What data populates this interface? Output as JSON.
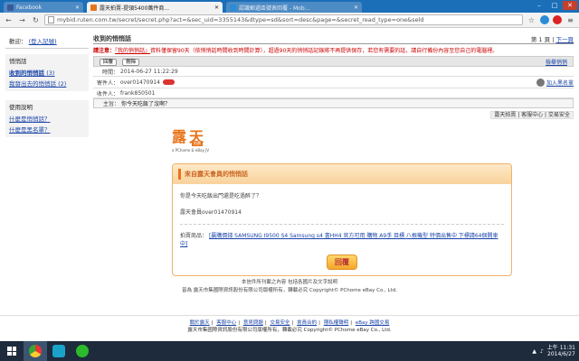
{
  "browser": {
    "tabs": [
      {
        "label": "Facebook",
        "active": false,
        "color": "#3b5998"
      },
      {
        "label": "露天拍賣-提領5400萬件商...",
        "active": true,
        "color": "#e8741a"
      },
      {
        "label": "認識郵遞區號表回覆 - Mob...",
        "active": false,
        "color": "#2a8bd6"
      }
    ],
    "address": "mybid.ruten.com.tw/secret/secret.php?act=&sec_uid=3355143&dtype=sd&sort=desc&page=&secret_read_type=one&seld",
    "controls": [
      "–",
      "□",
      "✕"
    ]
  },
  "sidebar": {
    "account_prefix": "歡迎：",
    "account_link": "(登入記號)",
    "msg_title": "悄悄話",
    "received_link": "收到的悄悄話",
    "received_count": "(3)",
    "sent_link": "我發出去的悄悄話",
    "sent_count": "(2)",
    "help_title": "使用說明",
    "help1": "什麼是悄悄話？",
    "help2": "什麼是黑名單？"
  },
  "main": {
    "title": "收到的悄悄話",
    "pager_current": "第 1 頁",
    "pager_next": "下一頁",
    "notice_lead": "請注意：",
    "notice_link": "『我的悄悄話』",
    "notice_text": "資料僅保留90天（依悄悄話時間收到時間計算），超過90天的悄悄話記錄將不再提供保存，若您有需要的話，請自行備份內容至您自己的電腦裡。",
    "btn_reply": "回覆",
    "btn_delete": "刪除",
    "report": "檢舉悄悄",
    "time_label": "時間：",
    "time_value": "2014-06-27 11:22:29",
    "sender_label": "寄件人：",
    "sender_value": "over01470914",
    "blacklist": "加入黑名單",
    "recipient_label": "收件人：",
    "recipient_value": "frank850501",
    "subject_label": "主旨：",
    "subject_value": "你今天吃飯了沒啊？",
    "links": "露天拍賣 | 客服中心 | 交易安全"
  },
  "mail": {
    "logo_char1": "露",
    "logo_char2": "天",
    "logo_badge": "拍賣",
    "logo_sub": "a PChome & eBay JV",
    "header": "來自露天會員的悄悄話",
    "line1": "你是今天吃飯出門還是吃過醉了？",
    "line2": "露天會員over01470914",
    "item_label": "拍賣商品：",
    "item_link": "[贏購價錢 SAMSUNG I9500 S4 Samsung s4 書HH4 官方可用 購物 A9手 目標 八根機型 特價出售中 下標請64個開車中]",
    "reply_button": "回覆"
  },
  "copyright": {
    "line1": "本信件所刊載之內容 包括各國片及文字說明",
    "line2": "皆為 露天市集國際資訊股份有限公司版權所有，轉載必究 Copyright©    PChome eBay Co., Ltd."
  },
  "footer": {
    "links": [
      "關於露天",
      "客服中心",
      "意見問題",
      "交易安全",
      "會員合約",
      "隱私權聲明",
      "eBay 跨國交易"
    ],
    "line2": "露天市集國際資訊股份有限公司版權所有，轉載必究 Copyright©    PChome eBay Co., Ltd."
  },
  "taskbar": {
    "apps": [
      {
        "name": "chrome",
        "color": "#e33"
      },
      {
        "name": "k",
        "color": "#1aa3c9"
      },
      {
        "name": "line",
        "color": "#2bba2b"
      }
    ],
    "time": "上午 11:31",
    "date": "2014/6/27"
  }
}
